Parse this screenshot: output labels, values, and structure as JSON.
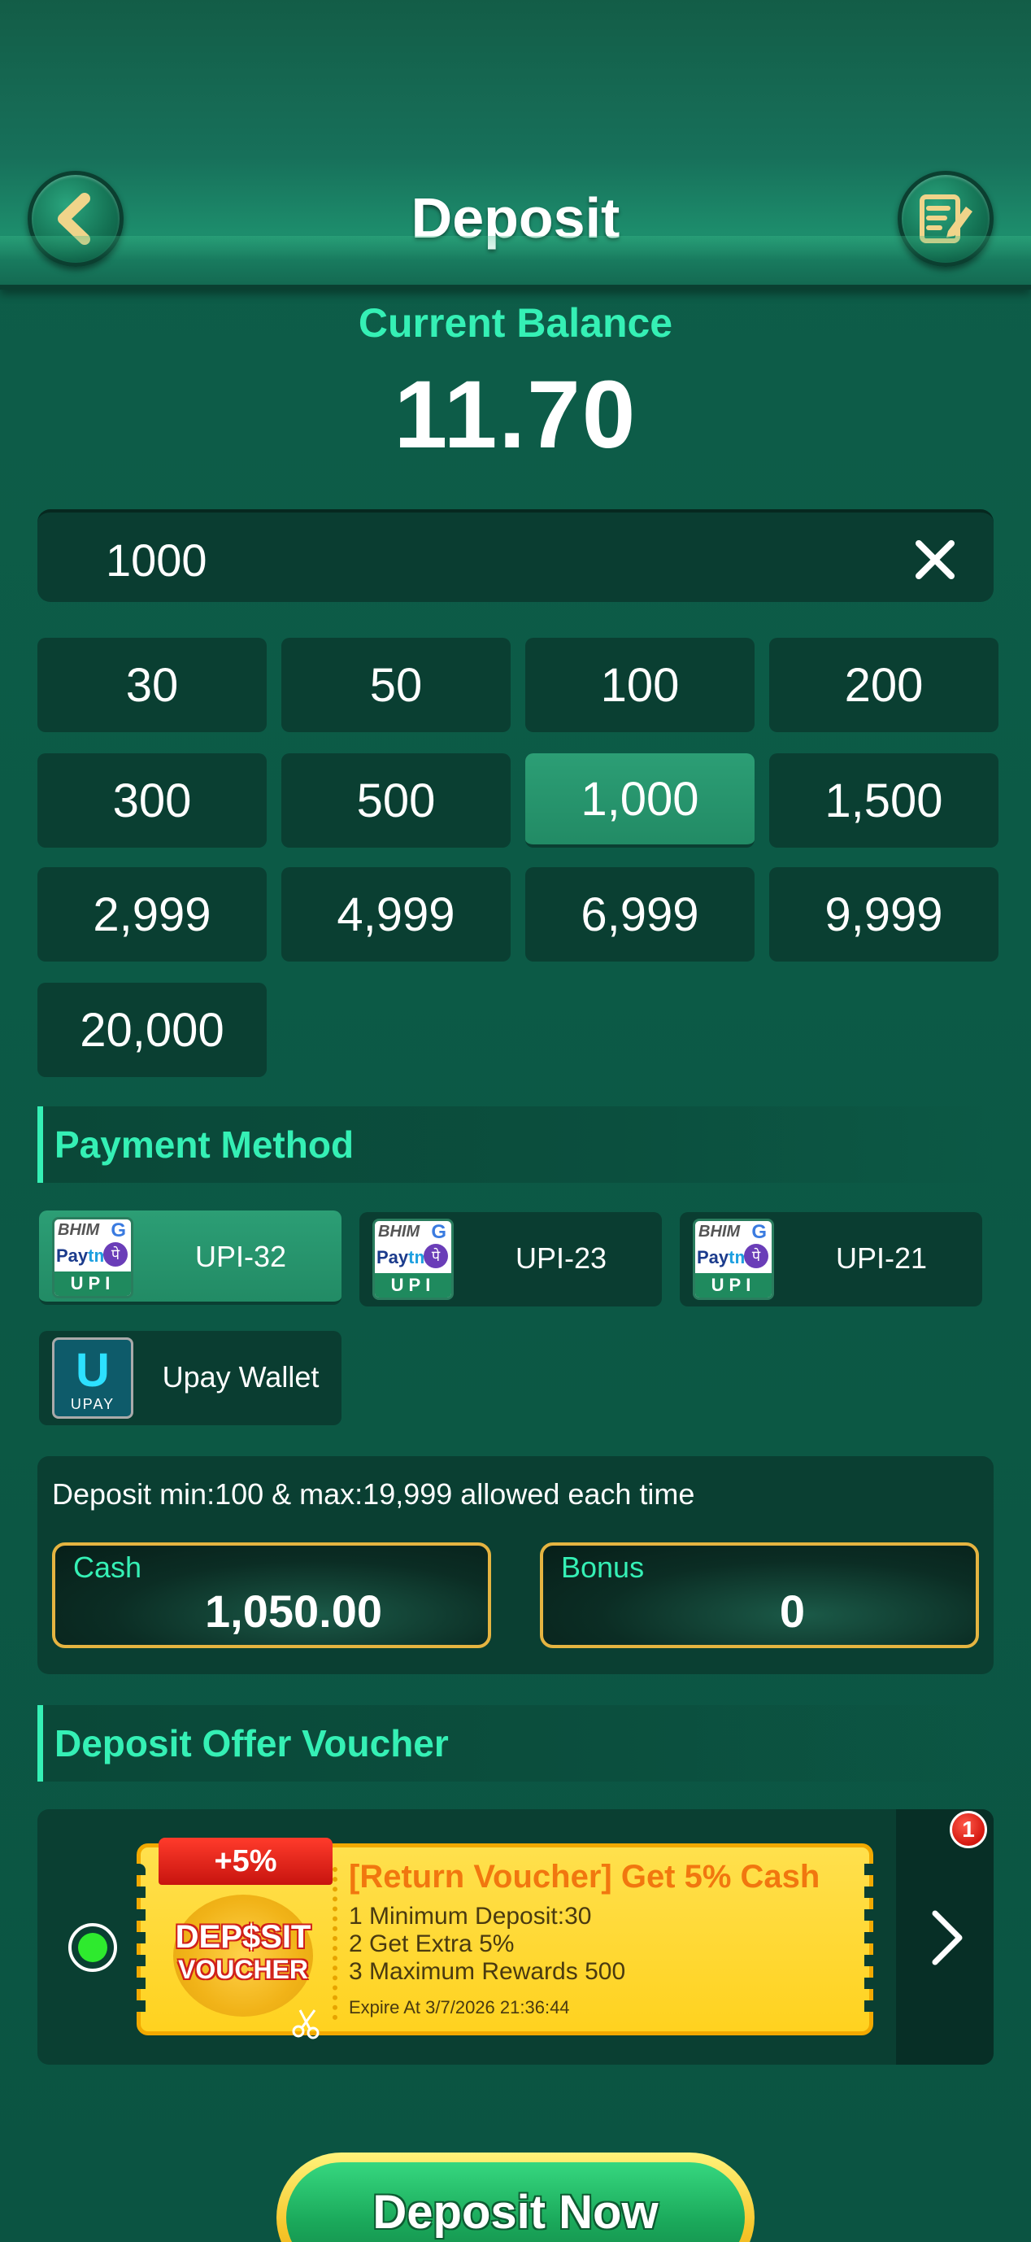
{
  "header": {
    "title": "Deposit",
    "back_icon": "chevron-left-icon",
    "record_icon": "edit-note-icon"
  },
  "balance": {
    "label": "Current Balance",
    "value": "11.70"
  },
  "amount_input": {
    "value": "1000",
    "clear_icon": "close-icon"
  },
  "amounts": [
    "30",
    "50",
    "100",
    "200",
    "300",
    "500",
    "1,000",
    "1,500",
    "2,999",
    "4,999",
    "6,999",
    "9,999",
    "20,000"
  ],
  "selected_amount": "1,000",
  "payment": {
    "section_title": "Payment Method",
    "methods": [
      {
        "label": "UPI-32",
        "logo": "upi-logo",
        "selected": true
      },
      {
        "label": "UPI-23",
        "logo": "upi-logo",
        "selected": false
      },
      {
        "label": "UPI-21",
        "logo": "upi-logo",
        "selected": false
      },
      {
        "label": "Upay Wallet",
        "logo": "upay-logo",
        "selected": false
      }
    ],
    "logo_text": {
      "bhim": "BHIM",
      "g": "G",
      "paytm_a": "Pay",
      "paytm_b": "tm",
      "pe": "पे",
      "upi": "UPI",
      "upay": "UPAY",
      "u": "U"
    }
  },
  "limits": {
    "text": "Deposit min:100 & max:19,999 allowed each time",
    "cash_label": "Cash",
    "cash_value": "1,050.00",
    "bonus_label": "Bonus",
    "bonus_value": "0"
  },
  "voucher": {
    "section_title": "Deposit Offer Voucher",
    "ribbon": "+5%",
    "emblem_line1": "DEP$SIT",
    "emblem_line2": "VOUCHER",
    "title": "[Return Voucher] Get 5% Cash",
    "lines": [
      "1 Minimum Deposit:30",
      "2 Get Extra 5%",
      "3 Maximum Rewards 500"
    ],
    "expire": "Expire At 3/7/2026 21:36:44",
    "badge_count": "1"
  },
  "actions": {
    "deposit_now": "Deposit Now"
  },
  "colors": {
    "accent": "#35f0b5",
    "selected": "#2c9e75",
    "panel": "#0a3f32",
    "gold": "#e5b441"
  }
}
